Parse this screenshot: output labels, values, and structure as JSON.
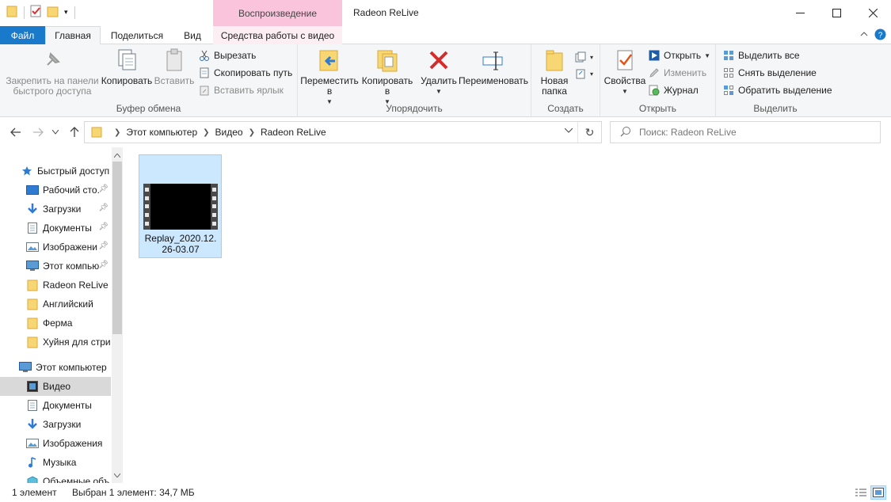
{
  "window": {
    "title": "Radeon ReLive",
    "context_tab_header": "Воспроизведение"
  },
  "tabs": {
    "file": "Файл",
    "home": "Главная",
    "share": "Поделиться",
    "view": "Вид",
    "video_tools": "Средства работы с видео"
  },
  "ribbon": {
    "clipboard": {
      "label": "Буфер обмена",
      "pin": "Закрепить на панели быстрого доступа",
      "copy": "Копировать",
      "paste": "Вставить",
      "cut": "Вырезать",
      "copy_path": "Скопировать путь",
      "paste_shortcut": "Вставить ярлык"
    },
    "organize": {
      "label": "Упорядочить",
      "move_to": "Переместить в",
      "copy_to": "Копировать в",
      "delete": "Удалить",
      "rename": "Переименовать"
    },
    "create": {
      "label": "Создать",
      "new_folder": "Новая папка"
    },
    "open": {
      "label": "Открыть",
      "properties": "Свойства",
      "open": "Открыть",
      "edit": "Изменить",
      "history": "Журнал"
    },
    "select": {
      "label": "Выделить",
      "select_all": "Выделить все",
      "select_none": "Снять выделение",
      "invert": "Обратить выделение"
    }
  },
  "address": {
    "crumbs": [
      "Этот компьютер",
      "Видео",
      "Radeon ReLive"
    ],
    "search_placeholder": "Поиск: Radeon ReLive"
  },
  "nav": {
    "quick_access": "Быстрый доступ",
    "quick_items": [
      "Рабочий сто.",
      "Загрузки",
      "Документы",
      "Изображени",
      "Этот компью",
      "Radeon ReLive",
      "Английский",
      "Ферма",
      "Хуйня для стри"
    ],
    "this_pc": "Этот компьютер",
    "pc_items": [
      "Видео",
      "Документы",
      "Загрузки",
      "Изображения",
      "Музыка",
      "Объемные объ"
    ]
  },
  "files": [
    {
      "name": "Replay_2020.12.26-03.07"
    }
  ],
  "status": {
    "count": "1 элемент",
    "selected": "Выбран 1 элемент: 34,7 МБ"
  },
  "colors": {
    "file_tab": "#1979ca",
    "context_tab": "#f9c4dc",
    "selection": "#cce8ff"
  }
}
